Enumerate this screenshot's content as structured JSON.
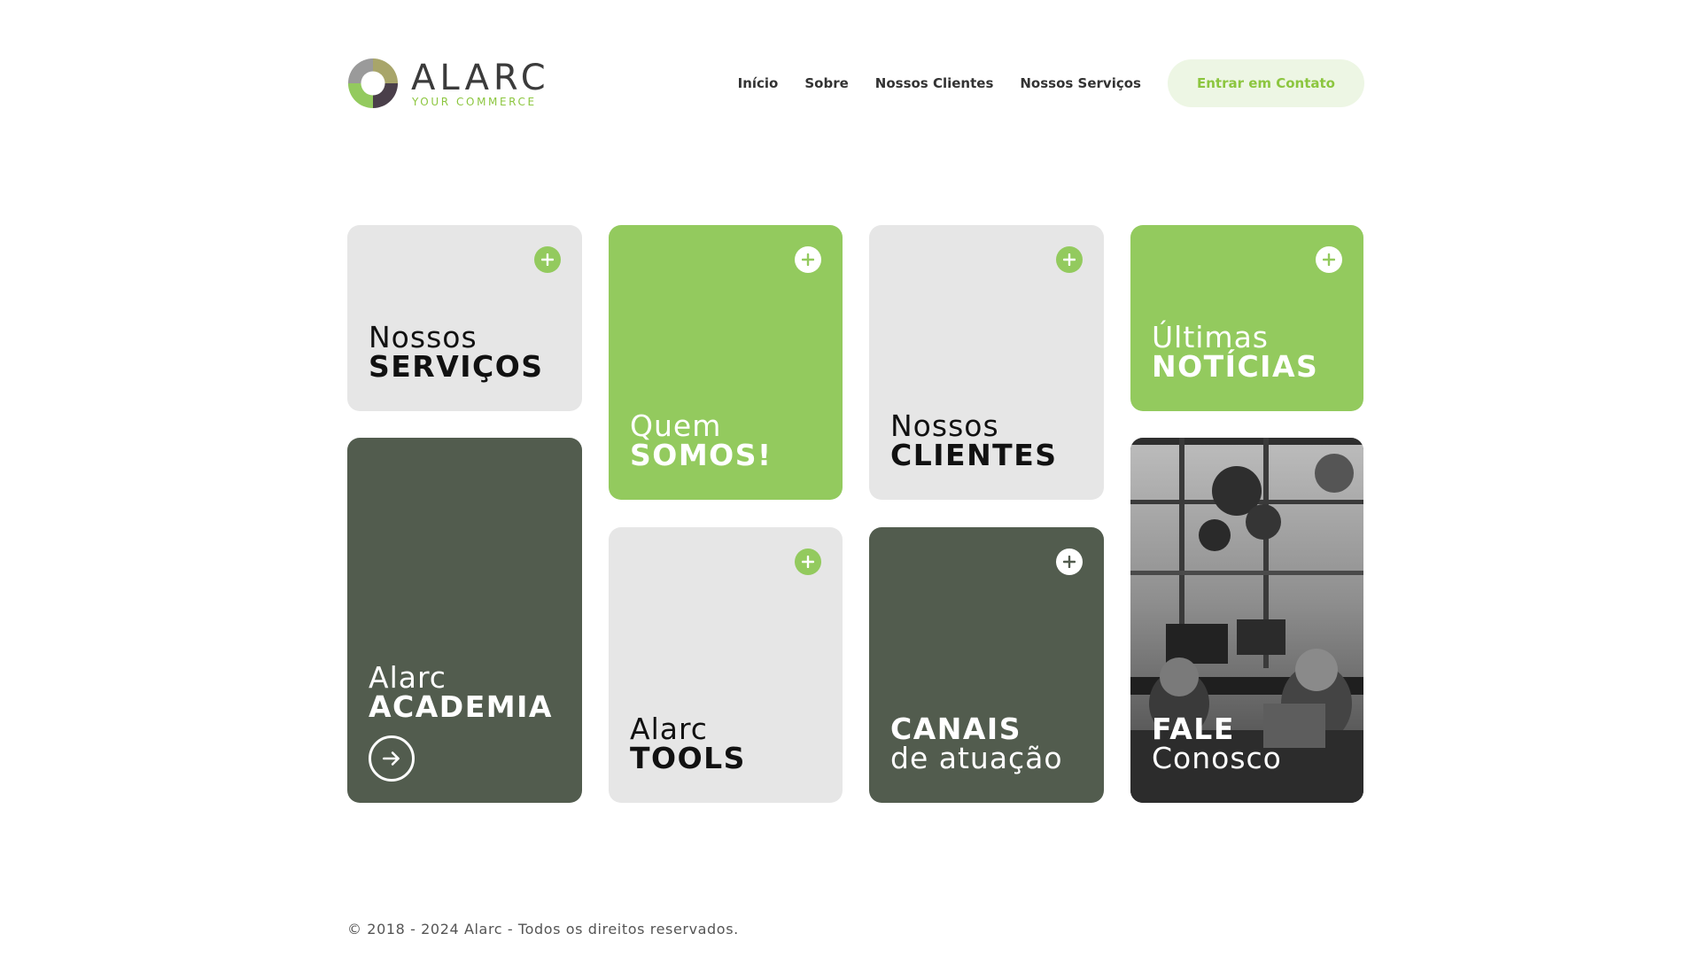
{
  "brand": {
    "name": "ALARC",
    "tagline": "YOUR COMMERCE",
    "colors": {
      "green": "#93ca5e",
      "dark": "#525c4e",
      "gray": "#e6e6e6",
      "olive": "#a8a56a",
      "plum": "#4a3f4a"
    }
  },
  "nav": {
    "links": [
      "Início",
      "Sobre",
      "Nossos Clientes",
      "Nossos Serviços"
    ],
    "cta": "Entrar em Contato"
  },
  "cards": {
    "servicos": {
      "light": "Nossos",
      "bold": "SERVIÇOS",
      "icon": "plus-icon"
    },
    "quem_somos": {
      "light": "Quem",
      "bold": "SOMOS!",
      "icon": "plus-icon"
    },
    "clientes": {
      "light": "Nossos",
      "bold": "CLIENTES",
      "icon": "plus-icon"
    },
    "noticias": {
      "light": "Últimas",
      "bold": "NOTÍCIAS",
      "icon": "plus-icon"
    },
    "academia": {
      "light": "Alarc",
      "bold": "ACADEMIA",
      "icon": "arrow-right-circle-icon"
    },
    "tools": {
      "light": "Alarc",
      "bold": "TOOLS",
      "icon": "plus-icon"
    },
    "canais": {
      "bold": "CANAIS",
      "light": "de atuação",
      "icon": "plus-icon"
    },
    "fale": {
      "bold": "FALE",
      "light": "Conosco"
    }
  },
  "footer": {
    "copyright": "© 2018 - 2024 Alarc - Todos os direitos reservados."
  }
}
